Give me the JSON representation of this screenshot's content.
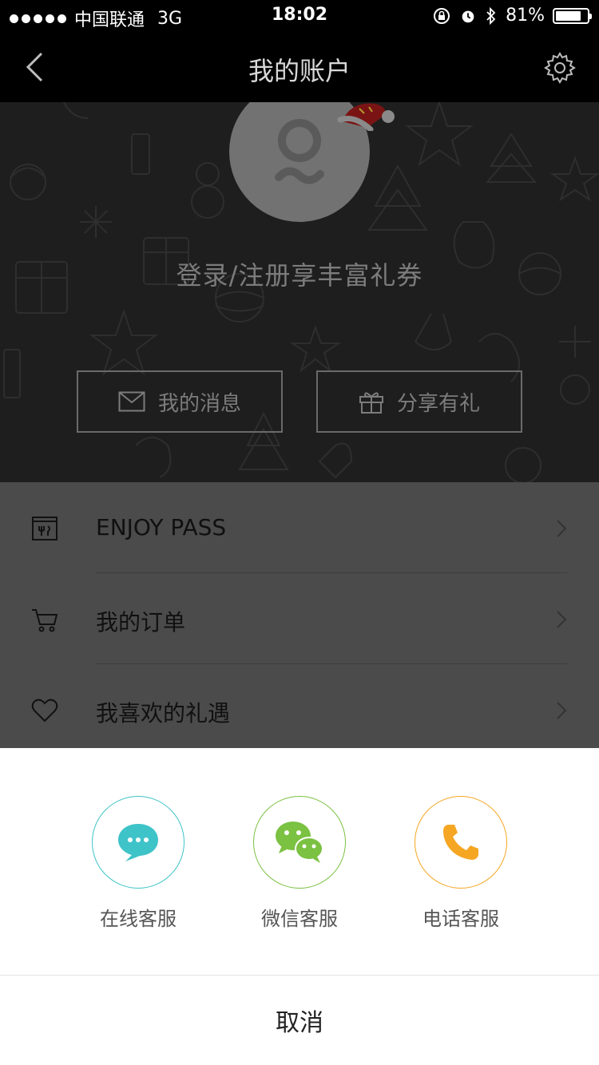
{
  "status_bar": {
    "carrier": "中国联通",
    "network": "3G",
    "time": "18:02",
    "battery": "81%",
    "battery_level": 0.81
  },
  "nav": {
    "title": "我的账户",
    "back_icon": "chevron-left-icon",
    "settings_icon": "gear-icon"
  },
  "hero": {
    "login_text": "登录/注册享丰富礼券",
    "buttons": [
      {
        "label": "我的消息",
        "icon": "envelope-icon"
      },
      {
        "label": "分享有礼",
        "icon": "gift-icon"
      }
    ]
  },
  "menu": {
    "items": [
      {
        "label": "ENJOY PASS",
        "icon": "pass-icon"
      },
      {
        "label": "我的订单",
        "icon": "cart-icon"
      },
      {
        "label": "我喜欢的礼遇",
        "icon": "heart-icon"
      }
    ]
  },
  "sheet": {
    "options": [
      {
        "label": "在线客服",
        "icon": "chat-bubble-icon",
        "color": "#3ec3c8"
      },
      {
        "label": "微信客服",
        "icon": "wechat-icon",
        "color": "#7bc142"
      },
      {
        "label": "电话客服",
        "icon": "phone-icon",
        "color": "#f5a623"
      }
    ],
    "cancel": "取消"
  }
}
